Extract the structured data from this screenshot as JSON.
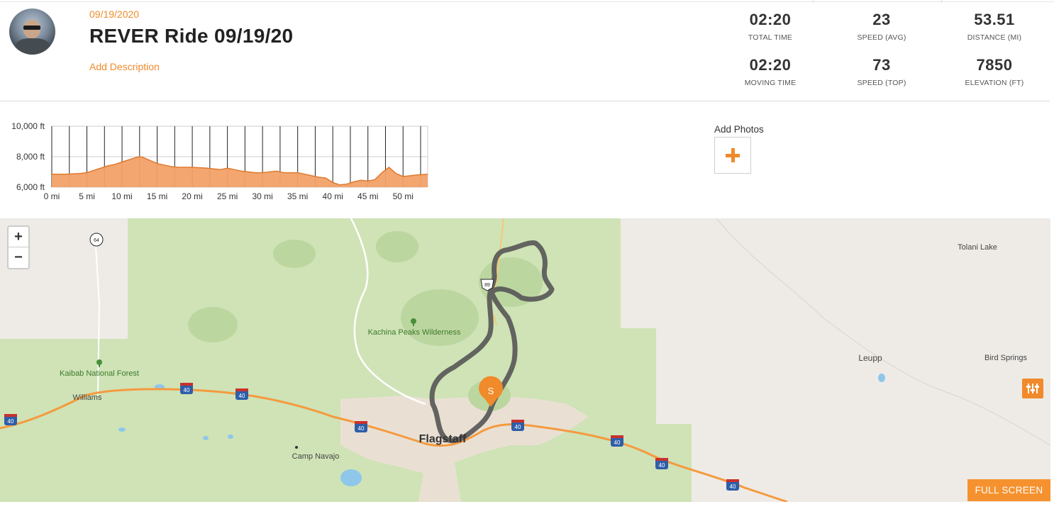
{
  "ride": {
    "date": "09/19/2020",
    "title": "REVER Ride 09/19/20",
    "add_description": "Add Description"
  },
  "stats": [
    {
      "value": "02:20",
      "label": "TOTAL TIME"
    },
    {
      "value": "23",
      "label": "SPEED (AVG)"
    },
    {
      "value": "53.51",
      "label": "DISTANCE (MI)"
    },
    {
      "value": "02:20",
      "label": "MOVING TIME"
    },
    {
      "value": "73",
      "label": "SPEED (TOP)"
    },
    {
      "value": "7850",
      "label": "ELEVATION (FT)"
    }
  ],
  "photos": {
    "label": "Add Photos"
  },
  "chart_data": {
    "type": "area",
    "title": "",
    "xlabel": "",
    "ylabel": "",
    "y_tick_labels": [
      "10,000 ft",
      "8,000 ft",
      "6,000 ft"
    ],
    "y_ticks": [
      10000,
      8000,
      6000
    ],
    "x_tick_labels": [
      "0 mi",
      "5 mi",
      "10 mi",
      "15 mi",
      "20 mi",
      "25 mi",
      "30 mi",
      "35 mi",
      "40 mi",
      "45 mi",
      "50 mi"
    ],
    "x_ticks": [
      0,
      5,
      10,
      15,
      20,
      25,
      30,
      35,
      40,
      45,
      50
    ],
    "xlim": [
      0,
      53.51
    ],
    "ylim": [
      6000,
      10000
    ],
    "grid": true,
    "fill_color": "#f2a168",
    "line_color": "#e07a2e",
    "series": [
      {
        "x": [
          0,
          2,
          4,
          5,
          6,
          7,
          8,
          9,
          10,
          11,
          12,
          12.5,
          13,
          14,
          15,
          16,
          17,
          18,
          20,
          22,
          24,
          25,
          26,
          27,
          28,
          29,
          30,
          32,
          33,
          34,
          35,
          36,
          37,
          38,
          39,
          40,
          41,
          42,
          43,
          44,
          45,
          46,
          47,
          48,
          49,
          50,
          51,
          52,
          53.51
        ],
        "y": [
          6850,
          6850,
          6900,
          6950,
          7100,
          7250,
          7400,
          7500,
          7650,
          7800,
          7950,
          8000,
          7950,
          7750,
          7550,
          7450,
          7350,
          7300,
          7300,
          7250,
          7150,
          7250,
          7150,
          7050,
          7000,
          6950,
          6950,
          7050,
          6950,
          6950,
          6950,
          6850,
          6750,
          6650,
          6600,
          6300,
          6150,
          6200,
          6350,
          6450,
          6400,
          6500,
          6950,
          7300,
          6900,
          6700,
          6750,
          6800,
          6850
        ]
      }
    ]
  },
  "map": {
    "zoom_in": "+",
    "zoom_out": "−",
    "labels": {
      "kachina": "Kachina Peaks Wilderness",
      "kaibab": "Kaibab National Forest",
      "williams": "Williams",
      "flagstaff": "Flagstaff",
      "camp_navajo": "Camp Navajo",
      "tolani": "Tolani Lake",
      "leupp": "Leupp",
      "bird_springs": "Bird Springs"
    },
    "shields": {
      "i40": "40",
      "us89": "89",
      "sr64": "64"
    },
    "start_marker": "S",
    "full_screen": "FULL SCREEN"
  }
}
